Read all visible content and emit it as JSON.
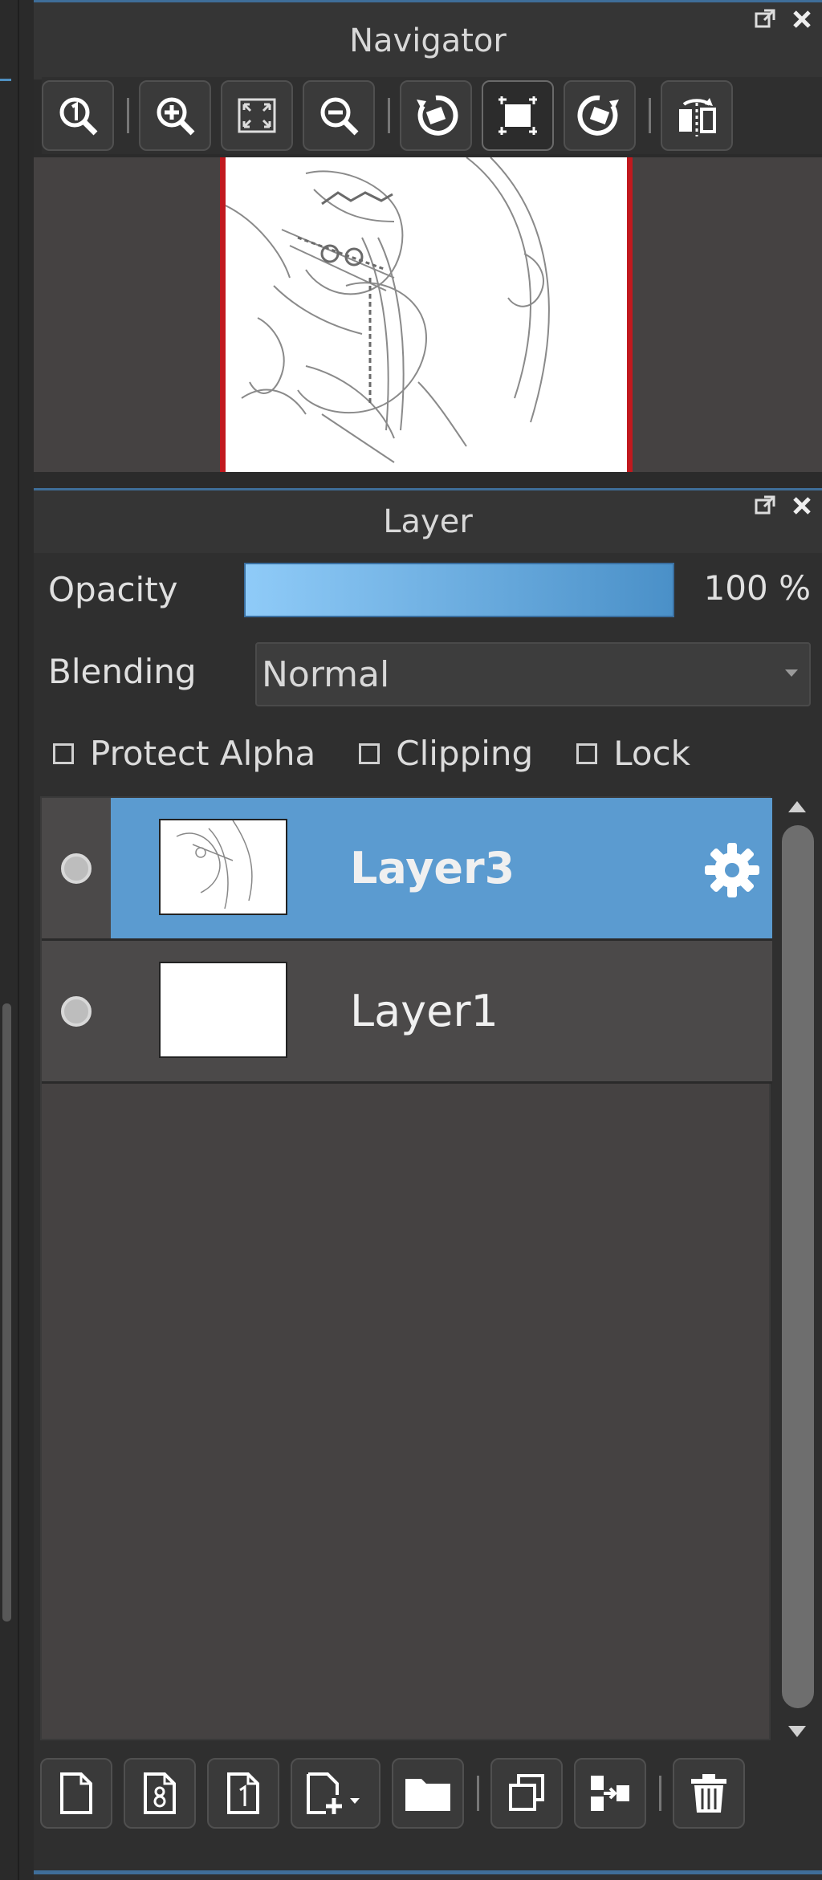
{
  "navigator": {
    "title": "Navigator",
    "toolbar": [
      "zoom-actual-icon",
      "zoom-in-icon",
      "fit-screen-icon",
      "zoom-out-icon",
      "rotate-left-icon",
      "fullscreen-icon",
      "rotate-right-icon",
      "flip-horizontal-icon"
    ]
  },
  "layer": {
    "title": "Layer",
    "opacity_label": "Opacity",
    "opacity_value": "100 %",
    "opacity_fraction": 1.0,
    "blending_label": "Blending",
    "blending_value": "Normal",
    "checkboxes": [
      {
        "label": "Protect Alpha",
        "checked": false
      },
      {
        "label": "Clipping",
        "checked": false
      },
      {
        "label": "Lock",
        "checked": false
      }
    ],
    "layers": [
      {
        "name": "Layer3",
        "selected": true,
        "visible": true
      },
      {
        "name": "Layer1",
        "selected": false,
        "visible": true
      }
    ],
    "bottom_toolbar": [
      "new-layer-icon",
      "new-8bit-layer-icon",
      "new-1bit-layer-icon",
      "add-layer-menu-icon",
      "new-folder-icon",
      "duplicate-layer-icon",
      "merge-layer-icon",
      "delete-layer-icon"
    ]
  },
  "colors": {
    "accent": "#3f6e99",
    "selected_row": "#5b9bd0",
    "canvas_border": "#c1191e"
  }
}
